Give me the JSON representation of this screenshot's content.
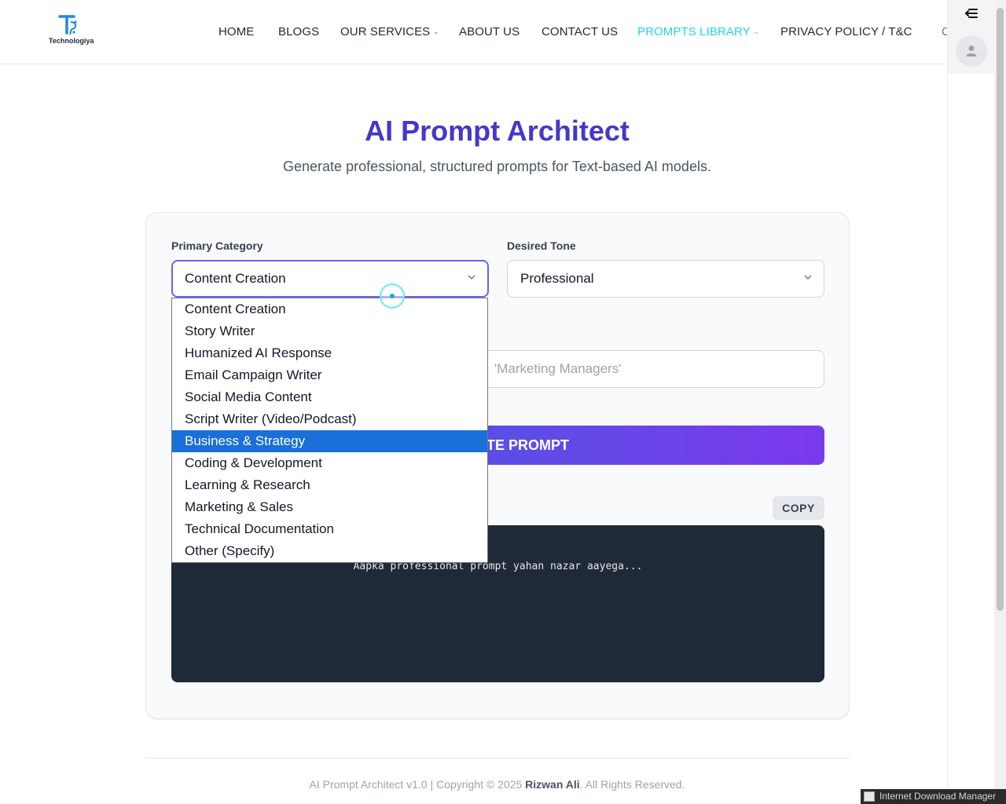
{
  "brand": {
    "logo_text": "Technologiya"
  },
  "nav": {
    "items": [
      {
        "label": "HOME",
        "dropdown": false,
        "active": false
      },
      {
        "label": "BLOGS",
        "dropdown": false,
        "active": false
      },
      {
        "label": "OUR SERVICES",
        "dropdown": true,
        "active": false
      },
      {
        "label": "ABOUT US",
        "dropdown": false,
        "active": false
      },
      {
        "label": "CONTACT US",
        "dropdown": false,
        "active": false
      },
      {
        "label": "PROMPTS LIBRARY",
        "dropdown": true,
        "active": true
      },
      {
        "label": "PRIVACY POLICY / T&C",
        "dropdown": false,
        "active": false
      }
    ],
    "chevron": "⌄",
    "active_color": "#22d3ee"
  },
  "hero": {
    "title": "AI Prompt Architect",
    "subtitle": "Generate professional, structured prompts for Text-based AI models."
  },
  "form": {
    "category": {
      "label": "Primary Category",
      "value": "Content Creation",
      "options": [
        "Content Creation",
        "Story Writer",
        "Humanized AI Response",
        "Email Campaign Writer",
        "Social Media Content",
        "Script Writer (Video/Podcast)",
        "Business & Strategy",
        "Coding & Development",
        "Learning & Research",
        "Marketing & Sales",
        "Technical Documentation",
        "Other (Specify)"
      ],
      "highlighted_option": "Business & Strategy",
      "open": true
    },
    "tone": {
      "label": "Desired Tone",
      "value": "Professional"
    },
    "audience_input": {
      "visible_placeholder": "'Marketing Managers'"
    },
    "generate_button": {
      "visible_label": "TE PROMPT"
    },
    "copy_button": {
      "label": "COPY"
    },
    "output": {
      "placeholder": "Aapka professional prompt yahan nazar aayega..."
    }
  },
  "footer": {
    "prefix": "AI Prompt Architect v1.0 | Copyright © 2025 ",
    "author": "Rizwan Ali",
    "suffix": ". All Rights Reserved."
  },
  "taskbar": {
    "app": "Internet Download Manager"
  },
  "colors": {
    "title": "#4338ca",
    "button_gradient_start": "#4338ca",
    "button_gradient_end": "#7c3aed",
    "output_bg": "#1f2937",
    "option_highlight": "#1a6fd9"
  }
}
